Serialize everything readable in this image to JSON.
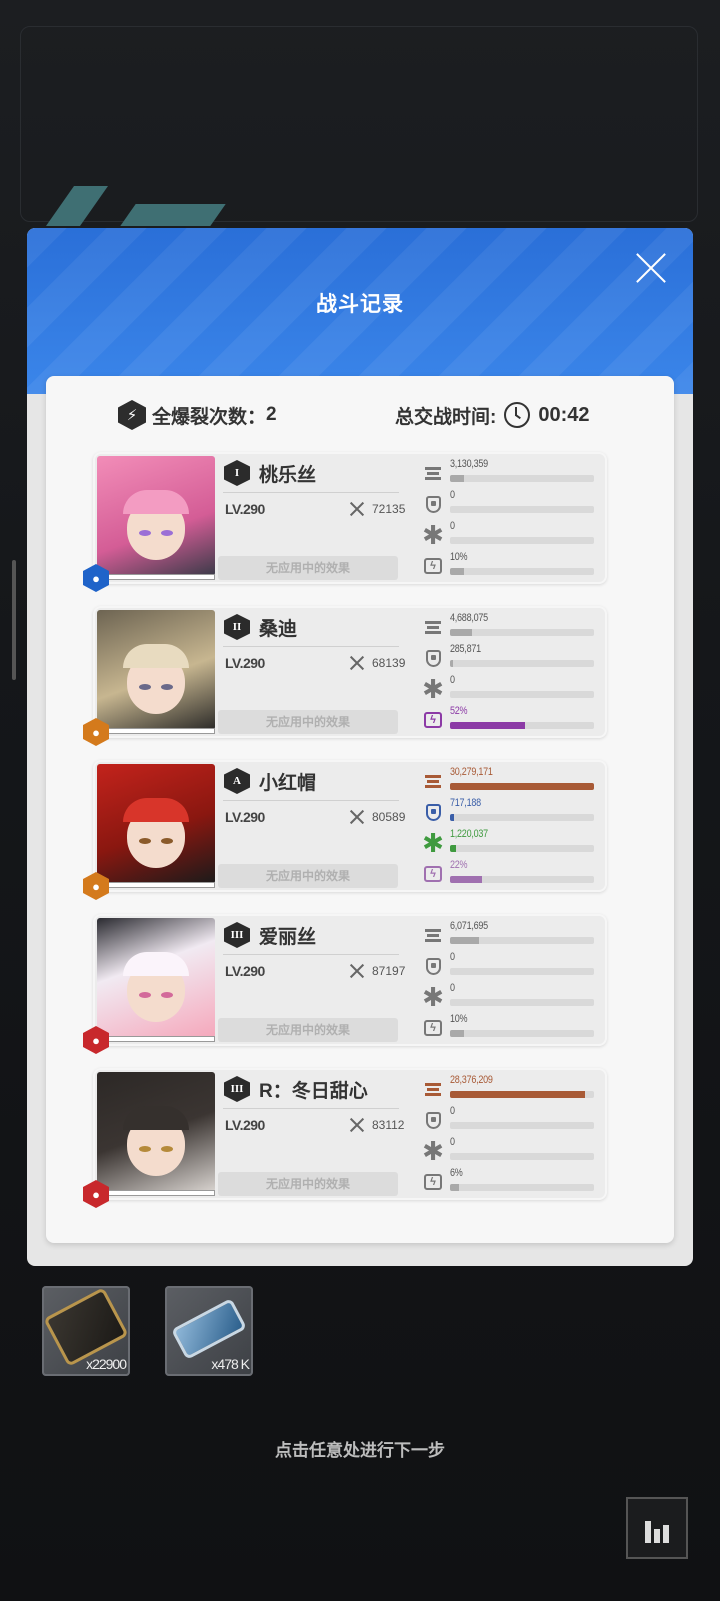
{
  "modal": {
    "title": "战斗记录",
    "burst_label": "全爆裂次数：",
    "burst_count": "2",
    "time_label": "总交战时间:",
    "time_value": "00:42"
  },
  "effect_placeholder": "无应用中的效果",
  "metric_types": [
    "damage-dealt",
    "damage-taken",
    "healing",
    "burst-gauge"
  ],
  "characters": [
    {
      "rank": "I",
      "name": "桃乐丝",
      "level": "LV.290",
      "kills": "72135",
      "class_icon": "water-drop-icon",
      "class_color": "#1f63c9",
      "metrics": [
        {
          "value": "3,130,359",
          "pct": 0.1
        },
        {
          "value": "0",
          "pct": 0
        },
        {
          "value": "0",
          "pct": 0
        },
        {
          "value": "10%",
          "pct": 0.1
        }
      ],
      "highlight": false
    },
    {
      "rank": "II",
      "name": "桑迪",
      "level": "LV.290",
      "kills": "68139",
      "class_icon": "iron-hex-icon",
      "class_color": "#d47a1c",
      "metrics": [
        {
          "value": "4,688,075",
          "pct": 0.15
        },
        {
          "value": "285,871",
          "pct": 0.01
        },
        {
          "value": "0",
          "pct": 0
        },
        {
          "value": "52%",
          "pct": 0.52
        }
      ],
      "highlight": "burst"
    },
    {
      "rank": "A",
      "name": "小红帽",
      "level": "LV.290",
      "kills": "80589",
      "class_icon": "iron-hex-icon",
      "class_color": "#d47a1c",
      "metrics": [
        {
          "value": "30,279,171",
          "pct": 1.0
        },
        {
          "value": "717,188",
          "pct": 0.025
        },
        {
          "value": "1,220,037",
          "pct": 0.04
        },
        {
          "value": "22%",
          "pct": 0.22
        }
      ],
      "highlight": "all"
    },
    {
      "rank": "III",
      "name": "爱丽丝",
      "level": "LV.290",
      "kills": "87197",
      "class_icon": "fire-icon",
      "class_color": "#c8282c",
      "metrics": [
        {
          "value": "6,071,695",
          "pct": 0.2
        },
        {
          "value": "0",
          "pct": 0
        },
        {
          "value": "0",
          "pct": 0
        },
        {
          "value": "10%",
          "pct": 0.1
        }
      ],
      "highlight": false
    },
    {
      "rank": "III",
      "name": "R：冬日甜心",
      "level": "LV.290",
      "kills": "83112",
      "class_icon": "fire-icon",
      "class_color": "#c8282c",
      "metrics": [
        {
          "value": "28,376,209",
          "pct": 0.94
        },
        {
          "value": "0",
          "pct": 0
        },
        {
          "value": "0",
          "pct": 0
        },
        {
          "value": "6%",
          "pct": 0.06
        }
      ],
      "highlight": "damage"
    }
  ],
  "rewards": [
    {
      "name": "credit-card-item",
      "quantity": "x22900"
    },
    {
      "name": "data-drive-item",
      "quantity": "x478 K"
    }
  ],
  "hint": "点击任意处进行下一步",
  "colors": {
    "header": "#2f78df",
    "damage": "#a85a36",
    "shield": "#3a5ea8",
    "heal": "#3f9a3f",
    "burst_purple": "#8c3aa6",
    "burst_light": "#a070b0"
  }
}
